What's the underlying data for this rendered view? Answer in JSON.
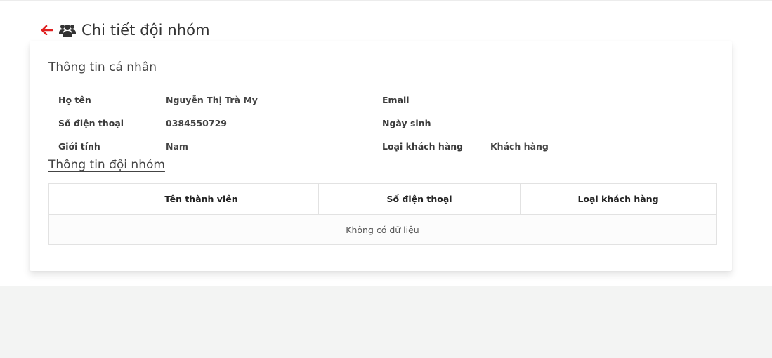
{
  "header": {
    "title": "Chi tiết đội nhóm",
    "back_icon": "arrow-left-icon",
    "group_icon": "users-icon",
    "back_color": "#e02020"
  },
  "personal_info": {
    "section_title": "Thông tin cá nhân",
    "fields": [
      {
        "label": "Họ tên",
        "value": "Nguyễn Thị Trà My"
      },
      {
        "label": "Số điện thoại",
        "value": "0384550729"
      },
      {
        "label": "Giới tính",
        "value": "Nam"
      },
      {
        "label": "Email",
        "value": ""
      },
      {
        "label": "Ngày sinh",
        "value": ""
      },
      {
        "label": "Loại khách hàng",
        "value": "Khách hàng"
      }
    ]
  },
  "team_info": {
    "section_title": "Thông tin đội nhóm",
    "columns": [
      "",
      "Tên thành viên",
      "Số điện thoại",
      "Loại khách hàng"
    ],
    "empty_text": "Không có dữ liệu"
  }
}
